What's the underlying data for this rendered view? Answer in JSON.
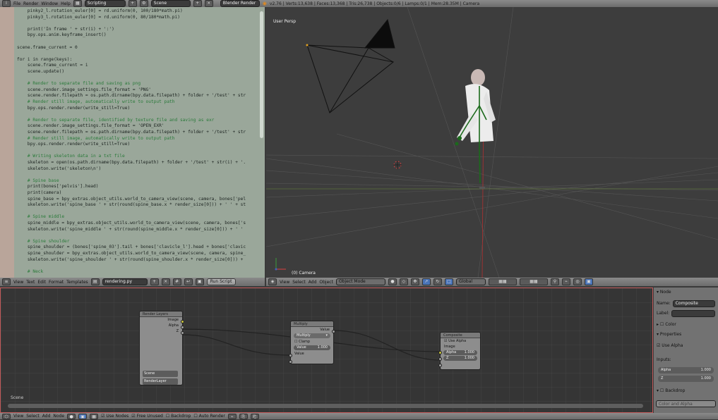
{
  "topbar": {
    "menus": [
      "File",
      "Render",
      "Window",
      "Help"
    ],
    "screen_layout": "Scripting",
    "scene": "Scene",
    "engine": "Blender Render",
    "stats": "v2.76 | Verts:13,638 | Faces:13,368 | Tris:26,738 | Objects:0/6 | Lamps:0/1 | Mem:28.35M | Camera"
  },
  "code_lines": [
    {
      "n": "",
      "t": "    pinky2_l.rotation_euler[0] = rd.uniform(0, 100/180*math.pi)",
      "c": ""
    },
    {
      "n": "",
      "t": "    pinky3_l.rotation_euler[0] = rd.uniform(0, 80/180*math.pi)",
      "c": ""
    },
    {
      "n": "",
      "t": "",
      "c": ""
    },
    {
      "n": "",
      "t": "    print('In frame ' + str(i) + ':')",
      "c": ""
    },
    {
      "n": "",
      "t": "    bpy.ops.anim.keyframe_insert()",
      "c": ""
    },
    {
      "n": "",
      "t": "",
      "c": ""
    },
    {
      "n": "",
      "t": "scene.frame_current = 0",
      "c": ""
    },
    {
      "n": "",
      "t": "",
      "c": ""
    },
    {
      "n": "",
      "t": "for i in range(keys):",
      "c": ""
    },
    {
      "n": "",
      "t": "    scene.frame_current = i",
      "c": ""
    },
    {
      "n": "",
      "t": "    scene.update()",
      "c": ""
    },
    {
      "n": "",
      "t": "",
      "c": ""
    },
    {
      "n": "",
      "t": "    # Render to separate file and saving as png",
      "c": "cm"
    },
    {
      "n": "",
      "t": "    scene.render.image_settings.file_format = 'PNG'",
      "c": ""
    },
    {
      "n": "",
      "t": "    scene.render.filepath = os.path.dirname(bpy.data.filepath) + folder + '/test' + str",
      "c": ""
    },
    {
      "n": "",
      "t": "    # Render still image, automatically write to output path",
      "c": "cm"
    },
    {
      "n": "",
      "t": "    bpy.ops.render.render(write_still=True)",
      "c": ""
    },
    {
      "n": "",
      "t": "",
      "c": ""
    },
    {
      "n": "",
      "t": "    # Render to separate file, identified by texture file and saving as exr",
      "c": "cm"
    },
    {
      "n": "",
      "t": "    scene.render.image_settings.file_format = 'OPEN_EXR'",
      "c": ""
    },
    {
      "n": "",
      "t": "    scene.render.filepath = os.path.dirname(bpy.data.filepath) + folder + '/test' + str",
      "c": ""
    },
    {
      "n": "",
      "t": "    # Render still image, automatically write to output path",
      "c": "cm"
    },
    {
      "n": "",
      "t": "    bpy.ops.render.render(write_still=True)",
      "c": ""
    },
    {
      "n": "",
      "t": "",
      "c": ""
    },
    {
      "n": "",
      "t": "    # Writing skeleton data in a txt file",
      "c": "cm"
    },
    {
      "n": "",
      "t": "    skeleton = open(os.path.dirname(bpy.data.filepath) + folder + '/test' + str(i) + '.",
      "c": ""
    },
    {
      "n": "",
      "t": "    skeleton.write('skeleton\\n')",
      "c": ""
    },
    {
      "n": "",
      "t": "",
      "c": ""
    },
    {
      "n": "",
      "t": "    # Spine base",
      "c": "cm"
    },
    {
      "n": "",
      "t": "    print(bones['pelvis'].head)",
      "c": ""
    },
    {
      "n": "",
      "t": "    print(camera)",
      "c": ""
    },
    {
      "n": "",
      "t": "    spine_base = bpy_extras.object_utils.world_to_camera_view(scene, camera, bones['pel",
      "c": ""
    },
    {
      "n": "",
      "t": "    skeleton.write('spine_base ' + str(round(spine_base.x * render_size[0])) + ' ' + st",
      "c": ""
    },
    {
      "n": "",
      "t": "",
      "c": ""
    },
    {
      "n": "",
      "t": "    # Spine middle",
      "c": "cm"
    },
    {
      "n": "",
      "t": "    spine_middle = bpy_extras.object_utils.world_to_camera_view(scene, camera, bones['s",
      "c": ""
    },
    {
      "n": "",
      "t": "    skeleton.write('spine_middle ' + str(round(spine_middle.x * render_size[0])) + ' '",
      "c": ""
    },
    {
      "n": "",
      "t": "",
      "c": ""
    },
    {
      "n": "",
      "t": "    # Spine shoulder",
      "c": "cm"
    },
    {
      "n": "",
      "t": "    spine_shoulder = (bones['spine_03'].tail + bones['clavicle_l'].head + bones['clavic",
      "c": ""
    },
    {
      "n": "",
      "t": "    spine_shoulder = bpy_extras.object_utils.world_to_camera_view(scene, camera, spine_",
      "c": ""
    },
    {
      "n": "",
      "t": "    skeleton.write('spine_shoulder ' + str(round(spine_shoulder.x * render_size[0])) +",
      "c": ""
    },
    {
      "n": "",
      "t": "",
      "c": ""
    },
    {
      "n": "",
      "t": "    # Neck",
      "c": "cm"
    }
  ],
  "editor_footer": {
    "menus": [
      "View",
      "Text",
      "Edit",
      "Format",
      "Templates"
    ],
    "filename": "rendering.py",
    "run": "Run Script"
  },
  "viewport": {
    "label": "User Persp",
    "object": "(0) Camera",
    "footer_menus": [
      "View",
      "Select",
      "Add",
      "Object"
    ],
    "mode": "Object Mode",
    "orientation": "Global"
  },
  "nodes": {
    "render_layers": {
      "title": "Render Layers",
      "outputs": [
        "Image",
        "Alpha",
        "Z"
      ],
      "scene": "Scene",
      "layer": "RenderLayer"
    },
    "multiply": {
      "title": "Multiply",
      "output": "Value",
      "op": "Multiply",
      "clamp": "Clamp",
      "value_label": "Value",
      "value": "1.000",
      "input": "Value"
    },
    "composite": {
      "title": "Composite",
      "use_alpha": "Use Alpha",
      "input": "Image",
      "alpha_label": "Alpha",
      "alpha": "1.000",
      "z_label": "Z",
      "z": "1.000"
    }
  },
  "node_status": "Scene",
  "node_footer": {
    "menus": [
      "View",
      "Select",
      "Add",
      "Node"
    ],
    "use_nodes": "Use Nodes",
    "free_unused": "Free Unused",
    "backdrop": "Backdrop",
    "auto_render": "Auto Render"
  },
  "props": {
    "node_header": "Node",
    "name_label": "Name:",
    "name": "Composite",
    "label_label": "Label:",
    "color": "Color",
    "properties": "Properties",
    "use_alpha": "Use Alpha",
    "inputs": "Inputs:",
    "alpha_label": "Alpha",
    "alpha": "1.000",
    "z_label": "Z",
    "z": "1.000",
    "backdrop": "Backdrop",
    "backdrop_mode": "Color and Alpha"
  }
}
